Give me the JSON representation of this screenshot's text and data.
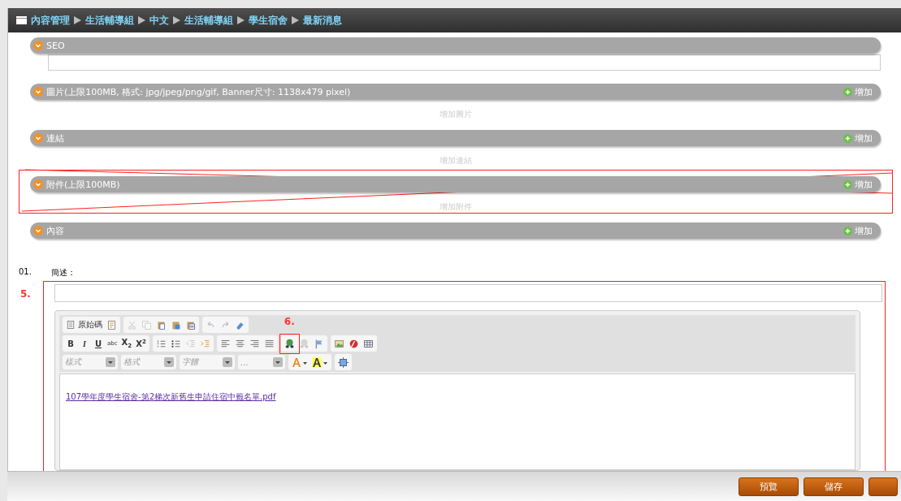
{
  "breadcrumb": [
    "內容管理",
    "生活輔導組",
    "中文",
    "生活輔導組",
    "學生宿舍",
    "最新消息"
  ],
  "sections": [
    {
      "kind": "field",
      "title": "SEO",
      "crossed_out": false
    },
    {
      "kind": "list",
      "title": "圖片(上限100MB, 格式: jpg/jpeg/png/gif, Banner尺寸: 1138x479 pixel)",
      "add_button": "增加",
      "empty_text": "增加圖片",
      "crossed_out": false
    },
    {
      "kind": "list",
      "title": "連結",
      "add_button": "增加",
      "empty_text": "增加連結",
      "crossed_out": false
    },
    {
      "kind": "list",
      "title": "附件(上限100MB)",
      "add_button": "增加",
      "empty_text": "增加附件",
      "crossed_out": true
    },
    {
      "kind": "header",
      "title": "內容",
      "add_button": "增加",
      "crossed_out": false
    }
  ],
  "form": {
    "number": "01.",
    "label": "簡述：",
    "highlight_label": "5.",
    "toolbar": [
      [
        [
          {
            "kind": "source",
            "label": "原始碼",
            "disabled": false
          },
          {
            "kind": "doc",
            "disabled": false
          }
        ],
        [
          {
            "kind": "cut",
            "disabled": true
          },
          {
            "kind": "copy",
            "disabled": true
          },
          {
            "kind": "paste",
            "disabled": false
          },
          {
            "kind": "paste-text",
            "disabled": false
          },
          {
            "kind": "paste-word",
            "disabled": false
          }
        ],
        [
          {
            "kind": "undo",
            "disabled": true
          },
          {
            "kind": "redo",
            "disabled": true
          },
          {
            "kind": "eraser",
            "disabled": false
          }
        ]
      ],
      [
        [
          {
            "kind": "bold",
            "label": "B",
            "disabled": false
          },
          {
            "kind": "italic",
            "label": "I",
            "disabled": false
          },
          {
            "kind": "underline",
            "label": "U",
            "disabled": false
          },
          {
            "kind": "strike",
            "label": "abc",
            "disabled": false
          },
          {
            "kind": "sub",
            "label": "X",
            "script": "2",
            "disabled": false
          },
          {
            "kind": "sup",
            "label": "X",
            "script": "2",
            "disabled": false
          }
        ],
        [
          {
            "kind": "ol",
            "disabled": false
          },
          {
            "kind": "ul",
            "disabled": false
          },
          {
            "kind": "outdent",
            "disabled": true
          },
          {
            "kind": "indent",
            "disabled": false
          }
        ],
        [
          {
            "kind": "align-left",
            "disabled": false
          },
          {
            "kind": "align-center",
            "disabled": false
          },
          {
            "kind": "align-right",
            "disabled": false
          },
          {
            "kind": "justify",
            "disabled": false
          }
        ],
        [
          {
            "kind": "link",
            "disabled": false,
            "highlight_label": "6."
          },
          {
            "kind": "unlink",
            "disabled": true
          },
          {
            "kind": "flag",
            "disabled": false
          }
        ],
        [
          {
            "kind": "image",
            "disabled": false
          },
          {
            "kind": "flash",
            "disabled": false
          },
          {
            "kind": "table",
            "disabled": false
          }
        ]
      ]
    ],
    "combos": [
      "樣式",
      "格式",
      "字體",
      "…"
    ],
    "link": "107學年度學生宿舍-第2梯次新舊生申請住宿中籤名單.pdf"
  },
  "buttons": [
    {
      "kind": "text",
      "label": "預覽"
    },
    {
      "kind": "text",
      "label": "儲存"
    },
    {
      "kind": "covered"
    }
  ]
}
